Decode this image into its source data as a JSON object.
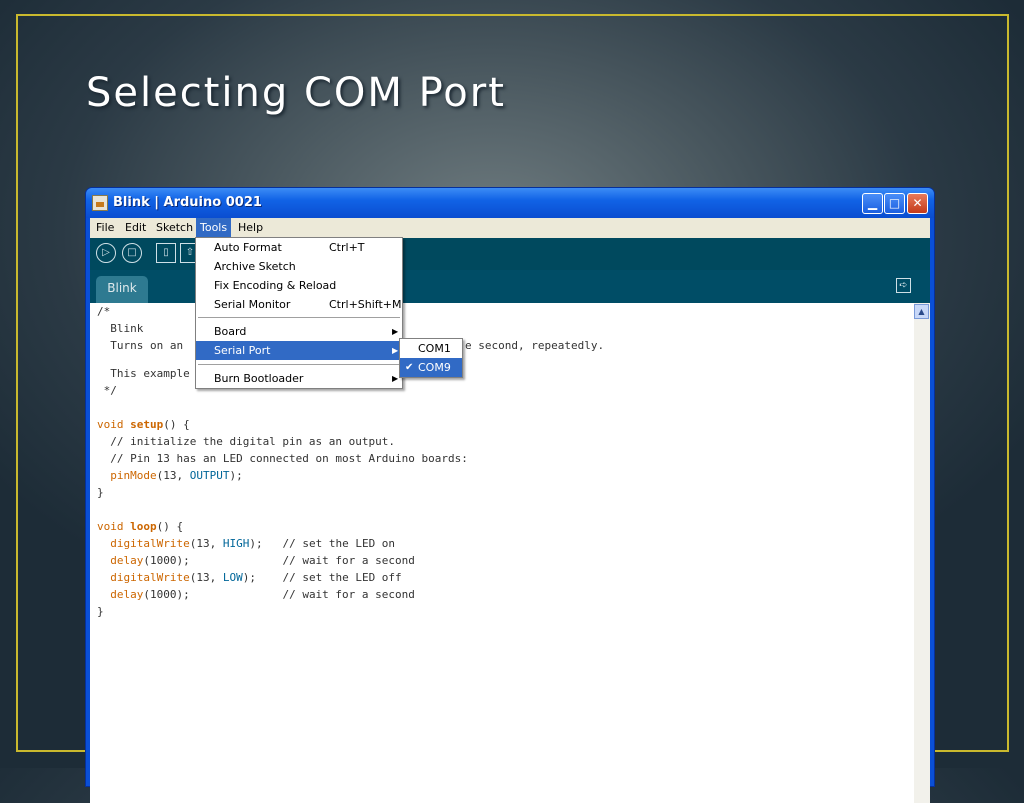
{
  "slide": {
    "title": "Selecting COM Port"
  },
  "window": {
    "title": "Blink | Arduino 0021"
  },
  "menubar": {
    "items": [
      "File",
      "Edit",
      "Sketch",
      "Tools",
      "Help"
    ]
  },
  "tab": {
    "label": "Blink"
  },
  "tools_menu": {
    "items": [
      {
        "label": "Auto Format",
        "shortcut": "Ctrl+T"
      },
      {
        "label": "Archive Sketch",
        "shortcut": ""
      },
      {
        "label": "Fix Encoding & Reload",
        "shortcut": ""
      },
      {
        "label": "Serial Monitor",
        "shortcut": "Ctrl+Shift+M"
      },
      {
        "label": "Board",
        "shortcut": ""
      },
      {
        "label": "Serial Port",
        "shortcut": ""
      },
      {
        "label": "Burn Bootloader",
        "shortcut": ""
      }
    ]
  },
  "serial_submenu": {
    "items": [
      {
        "label": "COM1",
        "checked": false
      },
      {
        "label": "COM9",
        "checked": true
      }
    ],
    "check_glyph": "✔"
  },
  "code": {
    "l1": "/*",
    "l2": "  Blink",
    "l3a": "  Turns on an",
    "l3b": "e second, repeatedly.",
    "l4": "  This example",
    "l5": " */",
    "l6_kw": "void ",
    "l6_fn": "setup",
    "l6_rest": "() {",
    "l7": "  // initialize the digital pin as an output.",
    "l8": "  // Pin 13 has an LED connected on most Arduino boards:",
    "l9_fn": "pinMode",
    "l9_a": "(13, ",
    "l9_c": "OUTPUT",
    "l9_b": ");",
    "l10": "}",
    "l11_kw": "void ",
    "l11_fn": "loop",
    "l11_rest": "() {",
    "l12_fn": "digitalWrite",
    "l12_a": "(13, ",
    "l12_c": "HIGH",
    "l12_b": ");   // set the LED on",
    "l13_fn": "delay",
    "l13_b": "(1000);              // wait for a second",
    "l14_fn": "digitalWrite",
    "l14_a": "(13, ",
    "l14_c": "LOW",
    "l14_b": ");    // set the LED off",
    "l15_fn": "delay",
    "l15_b": "(1000);              // wait for a second",
    "l16": "}"
  },
  "icons": {
    "colors": {
      "accent": "#316ac5",
      "title_border": "#c9b92e",
      "toolbar": "#00495e"
    }
  }
}
